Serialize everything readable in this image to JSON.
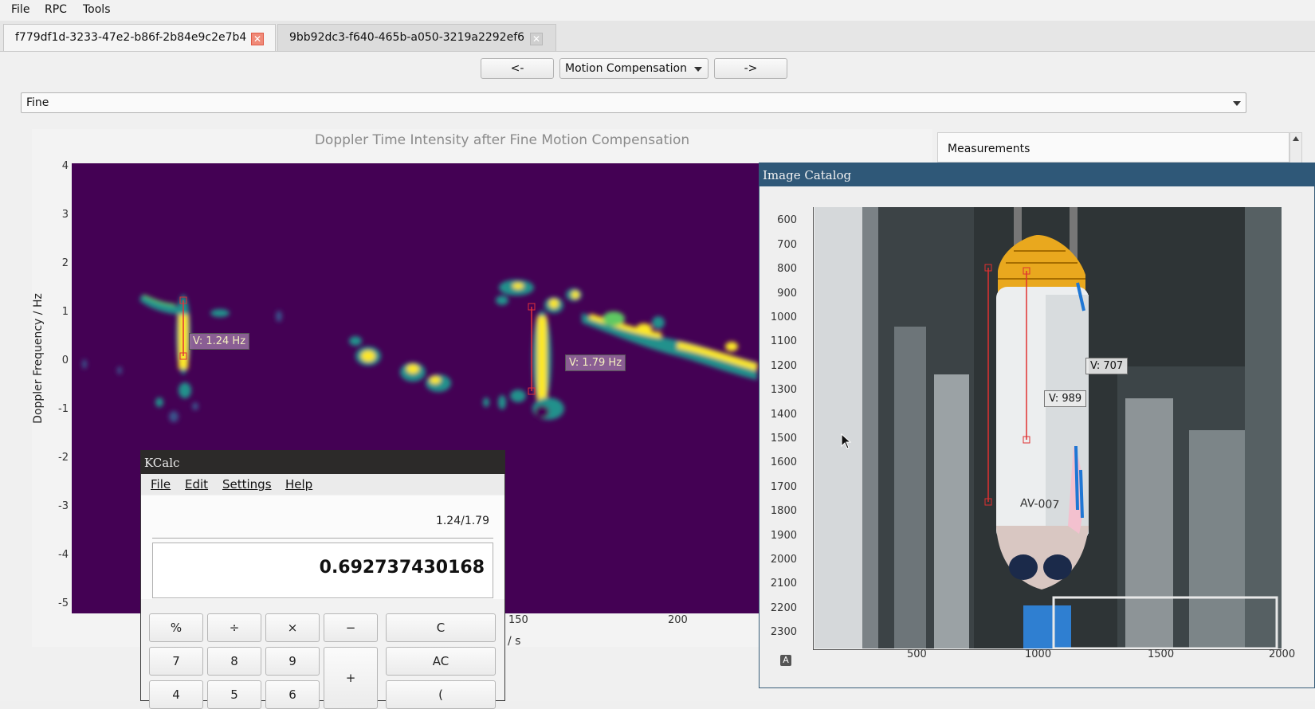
{
  "menubar": {
    "items": [
      "File",
      "RPC",
      "Tools"
    ]
  },
  "tabs": [
    {
      "label": "f779df1d-3233-47e2-b86f-2b84e9c2e7b4",
      "active": true
    },
    {
      "label": "9bb92dc3-f640-465b-a050-3219a2292ef6",
      "active": false
    }
  ],
  "nav": {
    "prev_label": "<-",
    "mode_value": "Motion Compensation",
    "next_label": "->"
  },
  "level_select": {
    "value": "Fine"
  },
  "plot": {
    "title": "Doppler Time Intensity after Fine Motion Compensation",
    "ylabel": "Doppler Frequency / Hz",
    "xlabel_visible": "/ s",
    "yticks": [
      "4",
      "3",
      "2",
      "1",
      "0",
      "-1",
      "-2",
      "-3",
      "-4",
      "-5"
    ],
    "xticks": [
      "150",
      "200"
    ],
    "annotations": [
      "V: 1.24 Hz",
      "V: 1.79 Hz"
    ],
    "colors": {
      "background": "#440154",
      "mid": "#21918c",
      "high": "#fde725"
    }
  },
  "measurements": {
    "title": "Measurements"
  },
  "image_catalog": {
    "title": "Image Catalog",
    "yticks": [
      "600",
      "700",
      "800",
      "900",
      "1000",
      "1100",
      "1200",
      "1300",
      "1400",
      "1500",
      "1600",
      "1700",
      "1800",
      "1900",
      "2000",
      "2100",
      "2200",
      "2300"
    ],
    "xticks": [
      "500",
      "1000",
      "1500",
      "2000"
    ],
    "annotations": [
      "V: 707",
      "V: 989"
    ],
    "vehicle_label": "AV-007",
    "corner_icon_label": "A"
  },
  "kcalc": {
    "title": "KCalc",
    "menu": [
      "File",
      "Edit",
      "Settings",
      "Help"
    ],
    "expression": "1.24/1.79",
    "result": "0.692737430168",
    "keys": [
      "%",
      "÷",
      "×",
      "−",
      "C",
      "7",
      "8",
      "9",
      "+",
      "AC",
      "4",
      "5",
      "6",
      "("
    ]
  }
}
